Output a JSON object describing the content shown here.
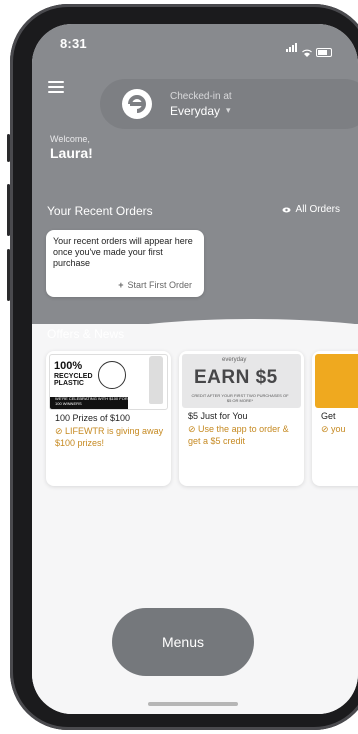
{
  "status_bar": {
    "time": "8:31"
  },
  "header": {
    "checkin_label": "Checked-in at",
    "checkin_location": "Everyday",
    "chevron": "▾"
  },
  "welcome": {
    "greeting": "Welcome,",
    "name": "Laura!"
  },
  "recent_orders": {
    "title": "Your Recent Orders",
    "all_orders_label": "All Orders",
    "empty_message": "Your recent orders will appear here once you've made your first purchase",
    "start_order_label": "Start First Order"
  },
  "offers": {
    "title": "Offers & News",
    "items": [
      {
        "title": "100 Prizes of $100",
        "description": "LIFEWTR is giving away $100 prizes!",
        "image_text_big": "100%",
        "image_text_small": "RECYCLED PLASTIC",
        "image_band": "WE'RE CELEBRATING WITH $100 FOR 100 WINNERS"
      },
      {
        "title": "$5 Just for You",
        "description": "Use the app to order & get a $5 credit",
        "image_brand": "everyday",
        "image_text_big": "EARN $5",
        "image_fine": "CREDIT AFTER YOUR FIRST TWO PURCHASES OF $5 OR MORE*"
      },
      {
        "title": "Get",
        "description": "you"
      }
    ]
  },
  "bottom": {
    "menus_label": "Menus"
  },
  "colors": {
    "accent_gold": "#c68a22",
    "header_grey": "#888a8e",
    "pill_grey": "#7d7f83",
    "menus_grey": "#75787c"
  }
}
